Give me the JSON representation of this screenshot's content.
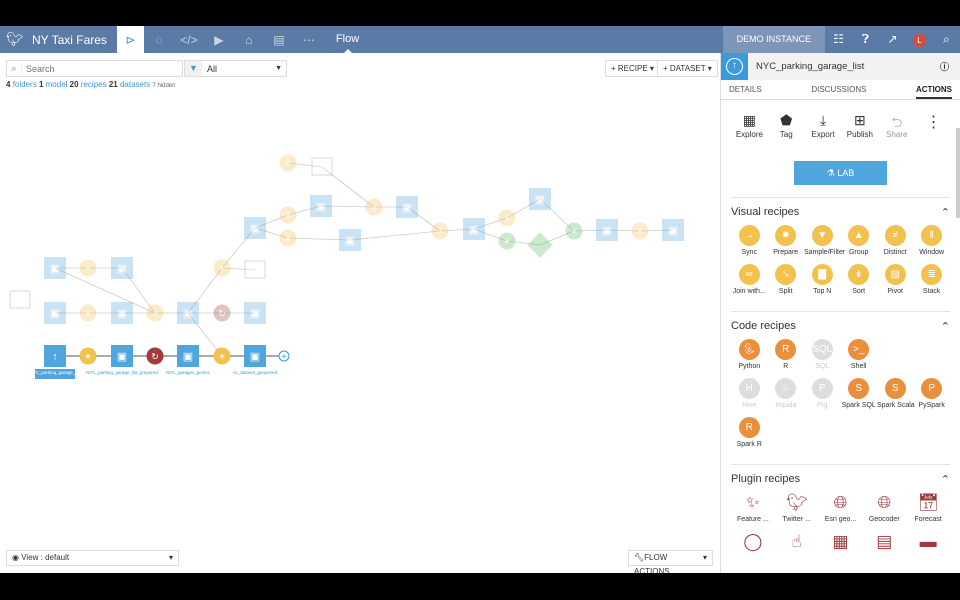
{
  "topbar": {
    "project": "NY Taxi Fares",
    "section": "Flow",
    "instance": "DEMO INSTANCE",
    "avatar": "L",
    "icons": [
      "flow-icon",
      "jobs-icon",
      "code-icon",
      "run-icon",
      "deploy-icon",
      "dashboard-icon",
      "more-icon"
    ]
  },
  "toolbar": {
    "search_placeholder": "Search",
    "filter_value": "All",
    "recipe_btn": "+ RECIPE",
    "dataset_btn": "+ DATASET"
  },
  "counts": {
    "folders_n": "4",
    "folders": "folders",
    "model_n": "1",
    "model": "model",
    "recipes_n": "20",
    "recipes": "recipes",
    "datasets_n": "21",
    "datasets": "datasets",
    "hidden": "7 hidden"
  },
  "flow": {
    "selected_labels": [
      "NYC_parking_garage_list",
      "NYC_parking_garage_list_prepared",
      "NYC_garages_geoloc",
      "nc_dataset_geojoined"
    ],
    "colors": {
      "dataset": "#4fa6dc",
      "visual_recipe": "#f2c14e",
      "code_recipe": "#a33b3b",
      "model": "#5cb85c"
    }
  },
  "bottom": {
    "view": "View : default",
    "flow_actions": "FLOW ACTIONS"
  },
  "panel": {
    "dataset_name": "NYC_parking_garage_list",
    "tabs": [
      "DETAILS",
      "DISCUSSIONS",
      "ACTIONS"
    ],
    "active_tab": "ACTIONS",
    "actions": [
      "Explore",
      "Tag",
      "Export",
      "Publish",
      "Share"
    ],
    "lab": "LAB",
    "visual_title": "Visual recipes",
    "visual": [
      "Sync",
      "Prepare",
      "Sample/Filter",
      "Group",
      "Distinct",
      "Window",
      "Join with...",
      "Split",
      "Top N",
      "Sort",
      "Pivot",
      "Stack"
    ],
    "code_title": "Code recipes",
    "code": [
      "Python",
      "R",
      "SQL",
      "Shell",
      "Hive",
      "Impala",
      "Pig",
      "Spark SQL",
      "Spark Scala",
      "PySpark",
      "Spark R"
    ],
    "code_disabled": [
      "SQL",
      "Hive",
      "Impala",
      "Pig"
    ],
    "plugin_title": "Plugin recipes",
    "plugin": [
      "Feature ...",
      "Twitter ...",
      "Esri geo...",
      "Geocoder",
      "Forecast"
    ]
  }
}
